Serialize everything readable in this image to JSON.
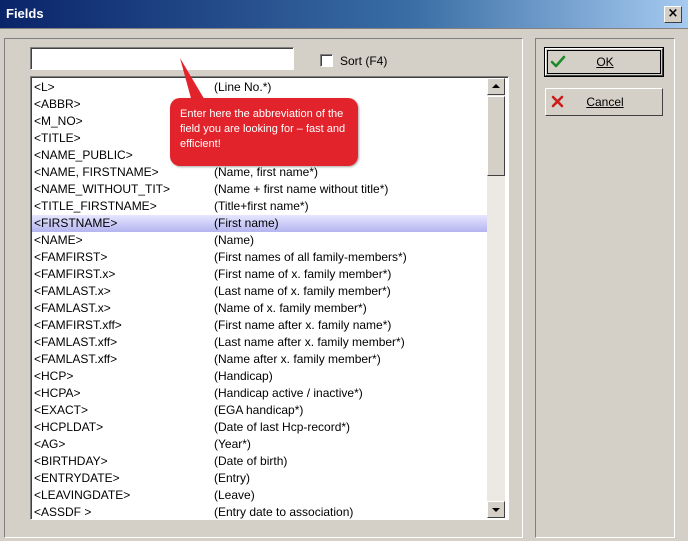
{
  "window": {
    "title": "Fields",
    "close_glyph": "×"
  },
  "search": {
    "value": "",
    "placeholder": ""
  },
  "sort": {
    "label": "Sort (F4)",
    "checked": false
  },
  "callout": {
    "text": "Enter here the abbreviation of the field you are looking for – fast and efficient!",
    "color": "#e3232b"
  },
  "buttons": {
    "ok": {
      "label": "OK",
      "icon": "check-icon"
    },
    "cancel": {
      "label": "Cancel",
      "icon": "cross-icon"
    }
  },
  "list": {
    "selected_index": 9,
    "rows": [
      {
        "abbr": "<L>",
        "desc": "(Line No.*)"
      },
      {
        "abbr": "<ABBR>",
        "desc": ""
      },
      {
        "abbr": "<M_NO>",
        "desc": ""
      },
      {
        "abbr": "<TITLE>",
        "desc": ""
      },
      {
        "abbr": "<NAME_PUBLIC>",
        "desc": ""
      },
      {
        "abbr": "<NAME, FIRSTNAME>",
        "desc": "(Name, first name*)"
      },
      {
        "abbr": "<NAME_WITHOUT_TIT>",
        "desc": "(Name + first name without title*)"
      },
      {
        "abbr": "<TITLE_FIRSTNAME>",
        "desc": "(Title+first name*)"
      },
      {
        "abbr": "<FIRSTNAME>",
        "desc": "(First name)"
      },
      {
        "abbr": "<NAME>",
        "desc": "(Name)"
      },
      {
        "abbr": "<FAMFIRST>",
        "desc": "(First names of all family-members*)"
      },
      {
        "abbr": "<FAMFIRST.x>",
        "desc": "(First name of x. family member*)"
      },
      {
        "abbr": "<FAMLAST.x>",
        "desc": "(Last name of x. family member*)"
      },
      {
        "abbr": "<FAMLAST.x>",
        "desc": "(Name of x. family member*)"
      },
      {
        "abbr": "<FAMFIRST.xff>",
        "desc": "(First name after x. family name*)"
      },
      {
        "abbr": "<FAMLAST.xff>",
        "desc": "(Last name after x. family member*)"
      },
      {
        "abbr": "<FAMLAST.xff>",
        "desc": "(Name after x. family member*)"
      },
      {
        "abbr": "<HCP>",
        "desc": "(Handicap)"
      },
      {
        "abbr": "<HCPA>",
        "desc": "(Handicap active / inactive*)"
      },
      {
        "abbr": "<EXACT>",
        "desc": "(EGA handicap*)"
      },
      {
        "abbr": "<HCPLDAT>",
        "desc": "(Date of last Hcp-record*)"
      },
      {
        "abbr": "<AG>",
        "desc": "(Year*)"
      },
      {
        "abbr": "<BIRTHDAY>",
        "desc": "(Date of birth)"
      },
      {
        "abbr": "<ENTRYDATE>",
        "desc": "(Entry)"
      },
      {
        "abbr": "<LEAVINGDATE>",
        "desc": "(Leave)"
      },
      {
        "abbr": "<ASSDF >",
        "desc": "(Entry date to association)"
      }
    ]
  }
}
